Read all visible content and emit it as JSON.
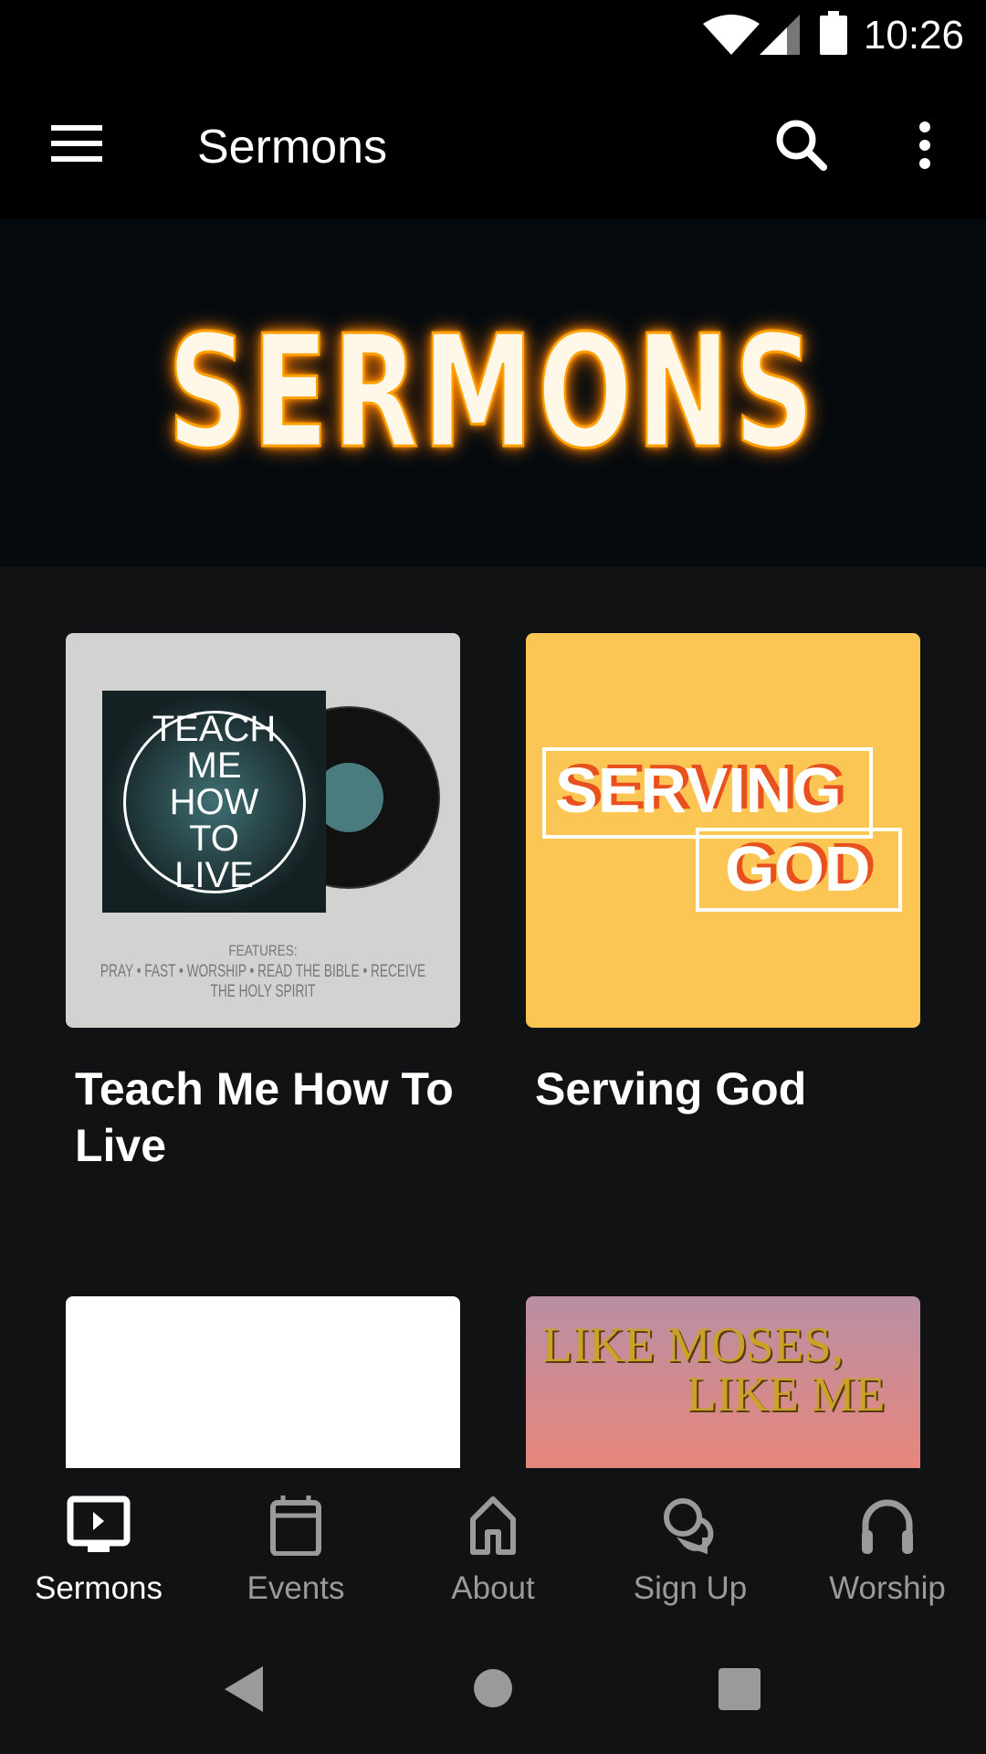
{
  "status_bar": {
    "time": "10:26"
  },
  "toolbar": {
    "title": "Sermons",
    "menu_icon": "hamburger-icon",
    "search_icon": "search-icon",
    "more_icon": "more-vert-icon"
  },
  "banner": {
    "text": "SERMONS"
  },
  "sermons": [
    {
      "title": "Teach Me How To Live",
      "art_title": "TEACH ME HOW TO LIVE",
      "art_features": "FEATURES:",
      "art_list": "PRAY • FAST • WORSHIP • READ THE BIBLE • RECEIVE THE HOLY SPIRIT"
    },
    {
      "title": "Serving God",
      "art_line1": "SERVING",
      "art_line2": "GOD",
      "bg": "#fcc655",
      "accent": "#e8501e"
    },
    {
      "title": ""
    },
    {
      "title": "",
      "art_line1": "LIKE MOSES,",
      "art_line2": "LIKE ME"
    }
  ],
  "bottom_nav": [
    {
      "label": "Sermons",
      "icon": "tv-play-icon",
      "active": true
    },
    {
      "label": "Events",
      "icon": "calendar-icon"
    },
    {
      "label": "About",
      "icon": "home-icon"
    },
    {
      "label": "Sign Up",
      "icon": "chat-bubbles-icon"
    },
    {
      "label": "Worship",
      "icon": "headphones-icon"
    }
  ]
}
